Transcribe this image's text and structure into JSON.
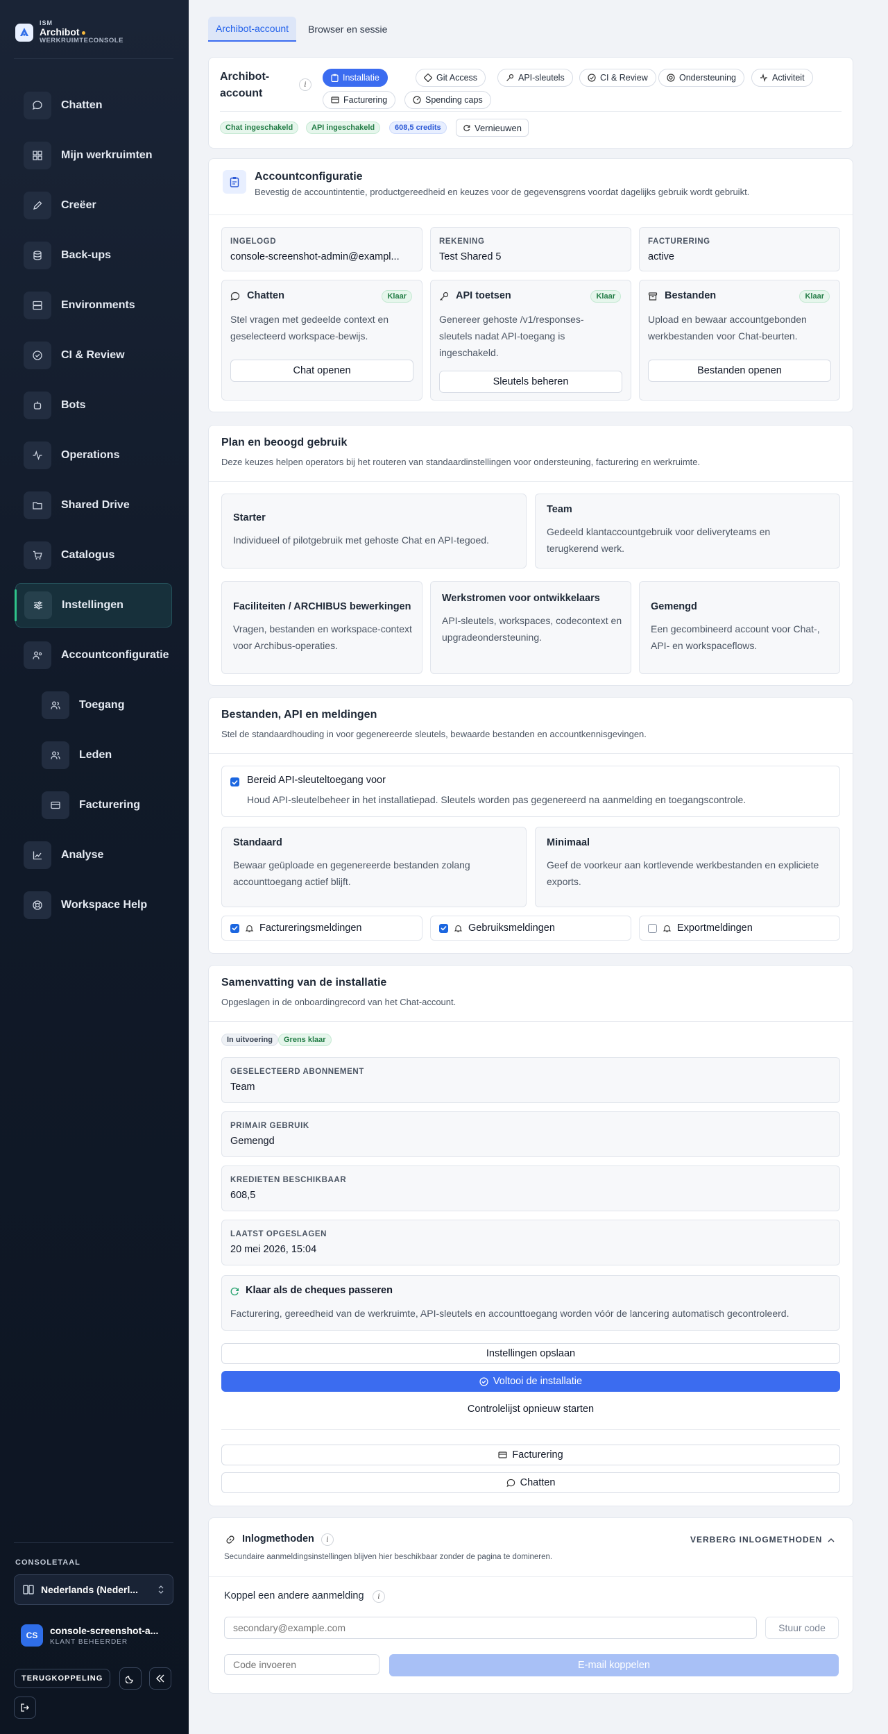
{
  "brand": {
    "small": "ISM",
    "name": "Archibot",
    "sub": "WERKRUIMTECONSOLE"
  },
  "nav": [
    {
      "label": "Chatten",
      "icon": "chat-icon"
    },
    {
      "label": "Mijn werkruimten",
      "icon": "grid-icon"
    },
    {
      "label": "Creëer",
      "icon": "pencil-icon"
    },
    {
      "label": "Back-ups",
      "icon": "database-icon"
    },
    {
      "label": "Environments",
      "icon": "server-icon"
    },
    {
      "label": "CI & Review",
      "icon": "check-circle-icon"
    },
    {
      "label": "Bots",
      "icon": "bot-icon"
    },
    {
      "label": "Operations",
      "icon": "activity-icon"
    },
    {
      "label": "Shared Drive",
      "icon": "folder-icon"
    },
    {
      "label": "Catalogus",
      "icon": "cart-icon"
    },
    {
      "label": "Instellingen",
      "icon": "sliders-icon",
      "active": true
    },
    {
      "label": "Accountconfiguratie",
      "icon": "users-gear-icon"
    },
    {
      "label": "Toegang",
      "icon": "users-icon",
      "sub": true
    },
    {
      "label": "Leden",
      "icon": "users-icon",
      "sub": true
    },
    {
      "label": "Facturering",
      "icon": "credit-card-icon",
      "sub": true
    },
    {
      "label": "Analyse",
      "icon": "chart-icon"
    },
    {
      "label": "Workspace Help",
      "icon": "lifebuoy-icon"
    }
  ],
  "sidebar_footer": {
    "lang_label": "CONSOLETAAL",
    "lang_value": "Nederlands (Nederl...",
    "user_initials": "CS",
    "user_name": "console-screenshot-a...",
    "user_role": "KLANT BEHEERDER",
    "feedback": "TERUGKOPPELING"
  },
  "top_tabs": [
    "Archibot-account",
    "Browser en sessie"
  ],
  "account": {
    "title": "Archibot-\naccount",
    "chips": [
      "Installatie",
      "Git Access",
      "API-sleutels",
      "CI & Review",
      "Ondersteuning",
      "Activiteit",
      "Facturering",
      "Spending caps"
    ],
    "badges": [
      "Chat ingeschakeld",
      "API ingeschakeld",
      "608,5 credits"
    ],
    "refresh": "Vernieuwen"
  },
  "config": {
    "title": "Accountconfiguratie",
    "subtitle": "Bevestig de accountintentie, productgereedheid en keuzes voor de gegevensgrens voordat dagelijks gebruik wordt gebruikt.",
    "facts": [
      {
        "label": "INGELOGD",
        "value": "console-screenshot-admin@exampl..."
      },
      {
        "label": "REKENING",
        "value": "Test Shared 5"
      },
      {
        "label": "FACTURERING",
        "value": "active"
      }
    ],
    "features": [
      {
        "title": "Chatten",
        "badge": "Klaar",
        "desc": "Stel vragen met gedeelde context en geselecteerd workspace-bewijs.",
        "button": "Chat openen"
      },
      {
        "title": "API toetsen",
        "badge": "Klaar",
        "desc": "Genereer gehoste /v1/responses-sleutels nadat API-toegang is ingeschakeld.",
        "button": "Sleutels beheren"
      },
      {
        "title": "Bestanden",
        "badge": "Klaar",
        "desc": "Upload en bewaar accountgebonden werkbestanden voor Chat-beurten.",
        "button": "Bestanden openen"
      }
    ]
  },
  "plan": {
    "title": "Plan en beoogd gebruik",
    "subtitle": "Deze keuzes helpen operators bij het routeren van standaardinstellingen voor ondersteuning, facturering en werkruimte.",
    "options": [
      {
        "title": "Starter",
        "desc": "Individueel of pilotgebruik met gehoste Chat en API-tegoed."
      },
      {
        "title": "Team",
        "desc": "Gedeeld klantaccountgebruik voor deliveryteams en terugkerend werk."
      },
      {
        "title": "Faciliteiten / ARCHIBUS bewerkingen",
        "desc": "Vragen, bestanden en workspace-context voor Archibus-operaties."
      },
      {
        "title": "Werkstromen voor ontwikkelaars",
        "desc": "API-sleutels, workspaces, codecontext en upgradeondersteuning."
      },
      {
        "title": "Gemengd",
        "desc": "Een gecombineerd account voor Chat-, API- en workspaceflows."
      }
    ]
  },
  "files": {
    "title": "Bestanden, API en meldingen",
    "subtitle": "Stel de standaardhouding in voor gegenereerde sleutels, bewaarde bestanden en accountkennisgevingen.",
    "api_check": {
      "title": "Bereid API-sleuteltoegang voor",
      "desc": "Houd API-sleutelbeheer in het installatiepad. Sleutels worden pas gegenereerd na aanmelding en toegangscontrole.",
      "checked": true
    },
    "retention": [
      {
        "title": "Standaard",
        "desc": "Bewaar geüploade en gegenereerde bestanden zolang accounttoegang actief blijft."
      },
      {
        "title": "Minimaal",
        "desc": "Geef de voorkeur aan kortlevende werkbestanden en expliciete exports."
      }
    ],
    "notifications": [
      {
        "label": "Factureringsmeldingen",
        "checked": true
      },
      {
        "label": "Gebruiksmeldingen",
        "checked": true
      },
      {
        "label": "Exportmeldingen",
        "checked": false
      }
    ]
  },
  "summary": {
    "title": "Samenvatting van de installatie",
    "subtitle": "Opgeslagen in de onboardingrecord van het Chat-account.",
    "badges": [
      "In uitvoering",
      "Grens klaar"
    ],
    "rows": [
      {
        "label": "GESELECTEERD ABONNEMENT",
        "value": "Team"
      },
      {
        "label": "PRIMAIR GEBRUIK",
        "value": "Gemengd"
      },
      {
        "label": "KREDIETEN BESCHIKBAAR",
        "value": "608,5"
      },
      {
        "label": "LAATST OPGESLAGEN",
        "value": "20 mei 2026, 15:04"
      }
    ],
    "ready_title": "Klaar als de cheques passeren",
    "ready_desc": "Facturering, gereedheid van de werkruimte, API-sleutels en accounttoegang worden vóór de lancering automatisch gecontroleerd.",
    "save": "Instellingen opslaan",
    "complete": "Voltooi de installatie",
    "restart": "Controlelijst opnieuw starten",
    "billing": "Facturering",
    "chat": "Chatten"
  },
  "login": {
    "title": "Inlogmethoden",
    "hide": "VERBERG INLOGMETHODEN",
    "subtitle": "Secundaire aanmeldingsinstellingen blijven hier beschikbaar zonder de pagina te domineren.",
    "link_title": "Koppel een andere aanmelding",
    "email_placeholder": "secondary@example.com",
    "send_code": "Stuur code",
    "code_placeholder": "Code invoeren",
    "link_email": "E-mail koppelen"
  },
  "colors": {
    "accent": "#3b6cf0",
    "active_nav": "#2fc48b",
    "sidebar_bg": "#111a29"
  }
}
